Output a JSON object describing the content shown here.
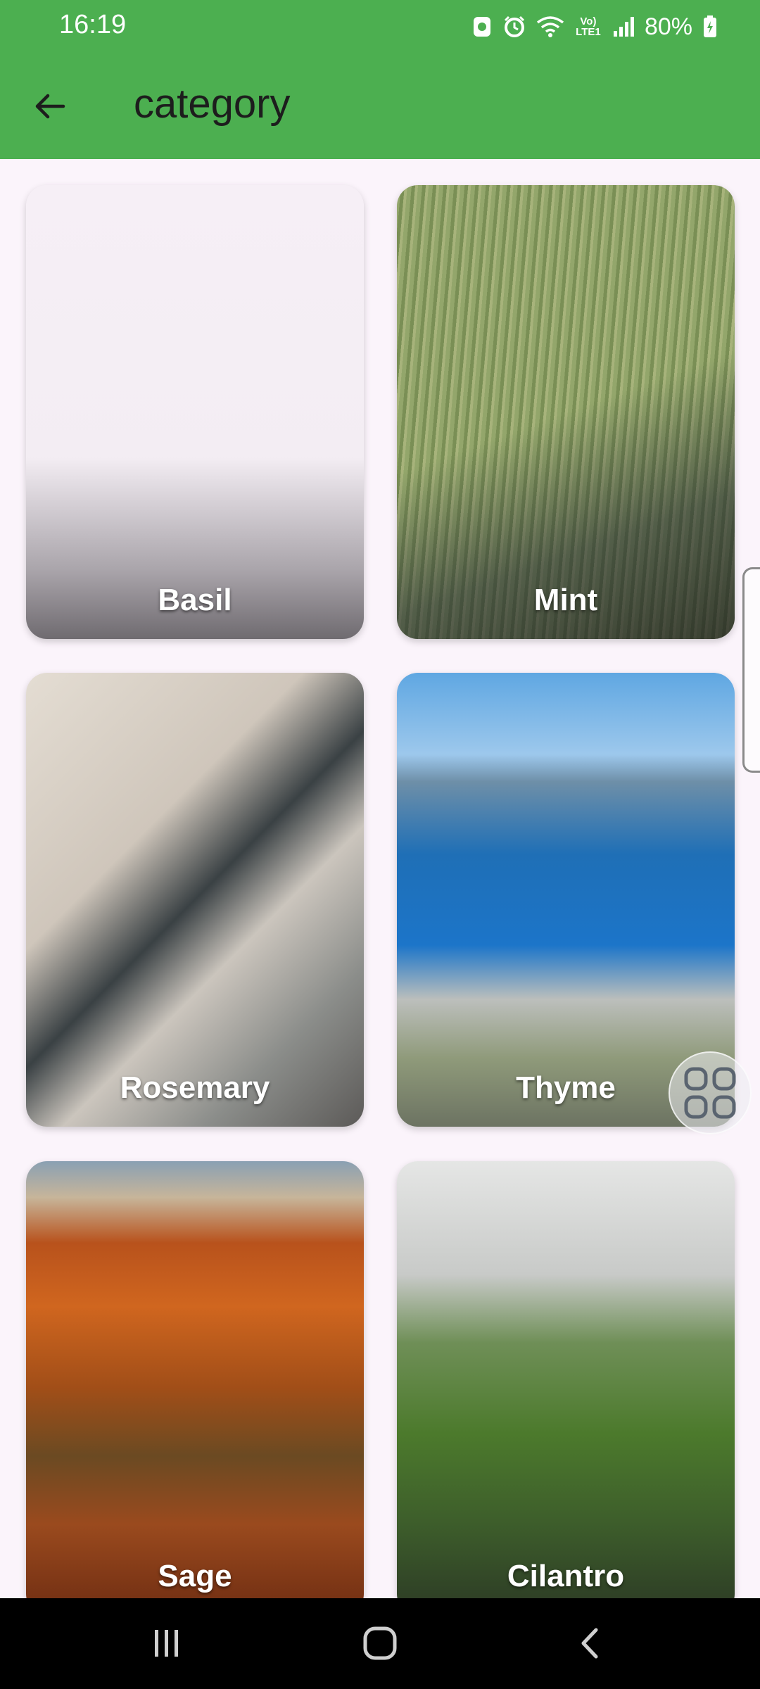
{
  "status_bar": {
    "time": "16:19",
    "battery_percent": "80%",
    "network_label": "Vo) LTE1",
    "icons": [
      "notification-icon",
      "alarm-icon",
      "wifi-icon",
      "volte-icon",
      "signal-icon",
      "battery-icon"
    ]
  },
  "app_bar": {
    "title": "category",
    "back_icon": "arrow-back-icon",
    "color": "#4caf50"
  },
  "categories": [
    {
      "label": "Basil"
    },
    {
      "label": "Mint"
    },
    {
      "label": "Rosemary"
    },
    {
      "label": "Thyme"
    },
    {
      "label": "Sage"
    },
    {
      "label": "Cilantro"
    }
  ],
  "floating_button": {
    "icon": "grid-menu-icon"
  },
  "nav_bar": {
    "buttons": [
      "recent-apps-icon",
      "home-icon",
      "back-icon"
    ]
  }
}
